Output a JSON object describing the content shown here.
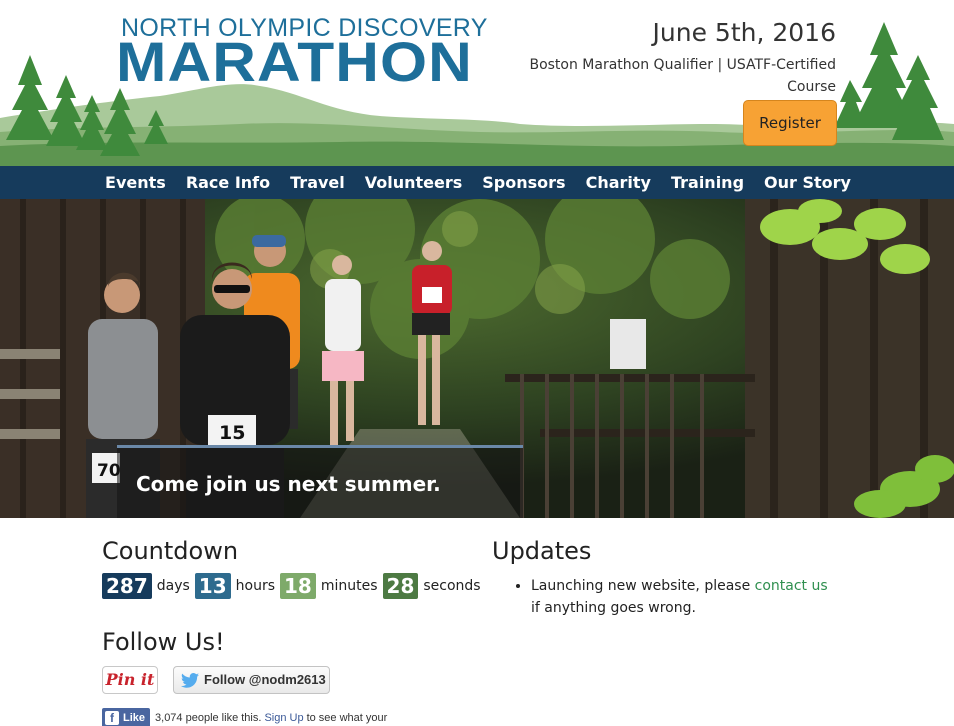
{
  "header": {
    "logo_top": "NORTH OLYMPIC DISCOVERY",
    "logo_main": "MARATHON",
    "date": "June 5th, 2016",
    "subtitle": "Boston Marathon Qualifier | USATF-Certified Course",
    "register_label": "Register"
  },
  "nav": {
    "items": [
      "Events",
      "Race Info",
      "Travel",
      "Volunteers",
      "Sponsors",
      "Charity",
      "Training",
      "Our Story"
    ]
  },
  "hero": {
    "caption": "Come join us next summer.",
    "bibs": [
      "70",
      "15"
    ]
  },
  "countdown": {
    "title": "Countdown",
    "units": [
      {
        "value": "287",
        "label": "days",
        "color": "#163b5c"
      },
      {
        "value": "13",
        "label": "hours",
        "color": "#2e6b8e"
      },
      {
        "value": "18",
        "label": "minutes",
        "color": "#7eaa6a"
      },
      {
        "value": "28",
        "label": "seconds",
        "color": "#4d7a43"
      }
    ]
  },
  "updates": {
    "title": "Updates",
    "item_before": "Launching new website, please ",
    "item_link": "contact us",
    "item_after": " if anything goes wrong."
  },
  "follow": {
    "title": "Follow Us!",
    "pinterest_label": "Pin it",
    "twitter_label": "Follow @nodm2613"
  },
  "facebook": {
    "like_label": "Like",
    "text_before": "3,074 people like this.",
    "signup": "Sign Up",
    "text_after": "to see what your"
  },
  "colors": {
    "brand_blue": "#1e6f9a",
    "nav_bg": "#163b5c",
    "register_orange": "#f7a234",
    "link_green": "#2f8f4f"
  }
}
